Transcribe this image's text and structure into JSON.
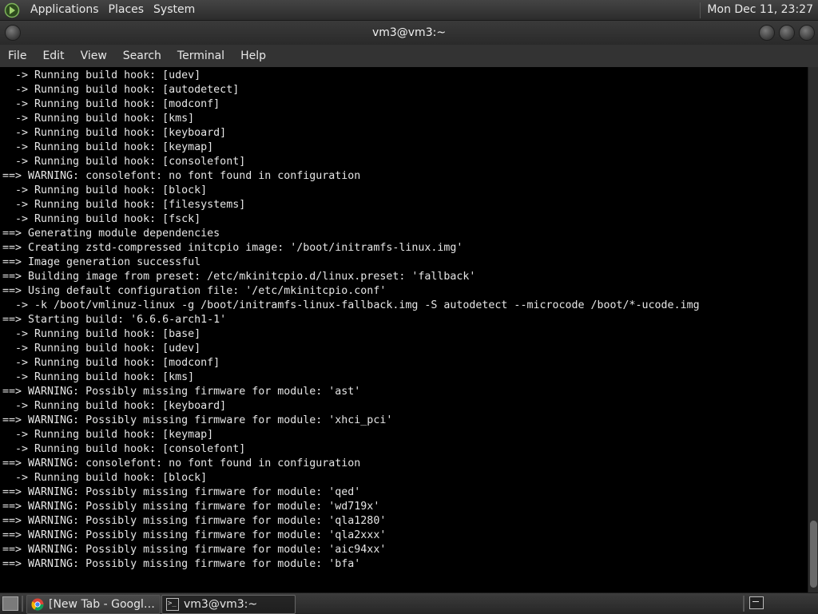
{
  "top_panel": {
    "menus": [
      "Applications",
      "Places",
      "System"
    ],
    "clock": "Mon Dec 11, 23:27",
    "logo_icon": "distro-logo-icon"
  },
  "window": {
    "title": "vm3@vm3:~"
  },
  "menubar": [
    "File",
    "Edit",
    "View",
    "Search",
    "Terminal",
    "Help"
  ],
  "terminal": {
    "lines": [
      "  -> Running build hook: [udev]",
      "  -> Running build hook: [autodetect]",
      "  -> Running build hook: [modconf]",
      "  -> Running build hook: [kms]",
      "  -> Running build hook: [keyboard]",
      "  -> Running build hook: [keymap]",
      "  -> Running build hook: [consolefont]",
      "==> WARNING: consolefont: no font found in configuration",
      "  -> Running build hook: [block]",
      "  -> Running build hook: [filesystems]",
      "  -> Running build hook: [fsck]",
      "==> Generating module dependencies",
      "==> Creating zstd-compressed initcpio image: '/boot/initramfs-linux.img'",
      "==> Image generation successful",
      "==> Building image from preset: /etc/mkinitcpio.d/linux.preset: 'fallback'",
      "==> Using default configuration file: '/etc/mkinitcpio.conf'",
      "  -> -k /boot/vmlinuz-linux -g /boot/initramfs-linux-fallback.img -S autodetect --microcode /boot/*-ucode.img",
      "==> Starting build: '6.6.6-arch1-1'",
      "  -> Running build hook: [base]",
      "  -> Running build hook: [udev]",
      "  -> Running build hook: [modconf]",
      "  -> Running build hook: [kms]",
      "==> WARNING: Possibly missing firmware for module: 'ast'",
      "  -> Running build hook: [keyboard]",
      "==> WARNING: Possibly missing firmware for module: 'xhci_pci'",
      "  -> Running build hook: [keymap]",
      "  -> Running build hook: [consolefont]",
      "==> WARNING: consolefont: no font found in configuration",
      "  -> Running build hook: [block]",
      "==> WARNING: Possibly missing firmware for module: 'qed'",
      "==> WARNING: Possibly missing firmware for module: 'wd719x'",
      "==> WARNING: Possibly missing firmware for module: 'qla1280'",
      "==> WARNING: Possibly missing firmware for module: 'qla2xxx'",
      "==> WARNING: Possibly missing firmware for module: 'aic94xx'",
      "==> WARNING: Possibly missing firmware for module: 'bfa'"
    ],
    "colors": {
      "background": "#000000",
      "foreground": "#e6e6e6"
    }
  },
  "taskbar": {
    "tasks": [
      {
        "label": "[New Tab - Google ...",
        "icon": "chrome-icon"
      },
      {
        "label": "vm3@vm3:~",
        "icon": "terminal-icon"
      }
    ],
    "tray_icon": "terminal-icon"
  }
}
